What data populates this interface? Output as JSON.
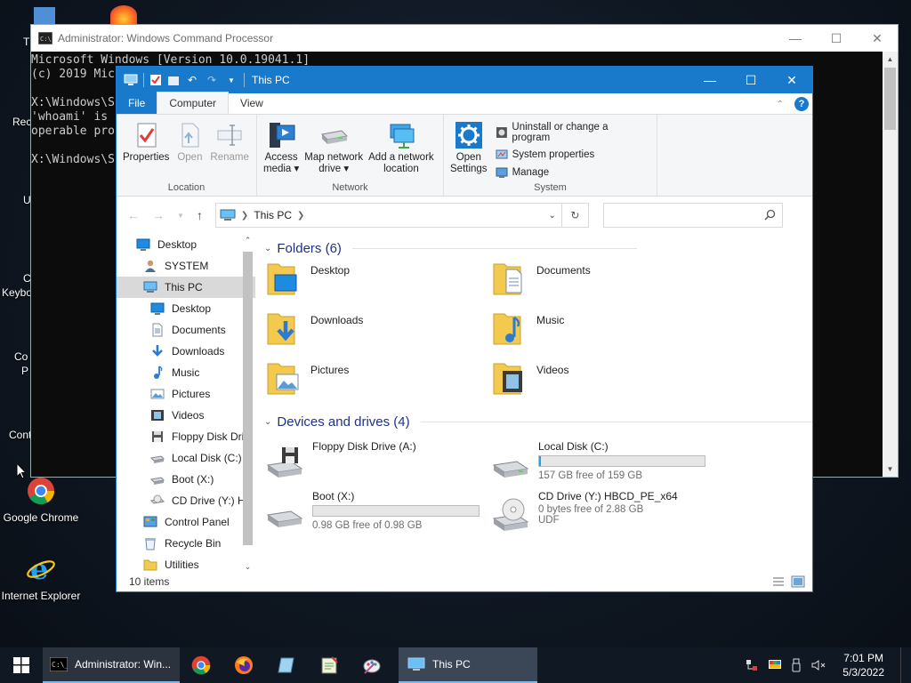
{
  "desktop": {
    "icons": [
      {
        "label": "Google Chrome"
      },
      {
        "label": "Internet Explorer"
      }
    ],
    "fragments": [
      "T",
      "Rec",
      "U",
      "C",
      "Keybo",
      "Co",
      "P",
      "Cont"
    ]
  },
  "cmd": {
    "title": "Administrator: Windows Command Processor",
    "lines": [
      "Microsoft Windows [Version 10.0.19041.1]",
      "(c) 2019 Mic",
      "",
      "X:\\Windows\\S",
      "'whoami' is",
      "operable pro",
      "",
      "X:\\Windows\\S"
    ]
  },
  "explorer": {
    "title": "This PC",
    "tabs": {
      "file": "File",
      "computer": "Computer",
      "view": "View"
    },
    "ribbon": {
      "location": {
        "name": "Location",
        "buttons": {
          "properties": "Properties",
          "open": "Open",
          "rename": "Rename"
        }
      },
      "network": {
        "name": "Network",
        "buttons": {
          "access_media_1": "Access",
          "access_media_2": "media ▾",
          "map_drive_1": "Map network",
          "map_drive_2": "drive ▾",
          "add_location_1": "Add a network",
          "add_location_2": "location"
        }
      },
      "system": {
        "name": "System",
        "open_settings_1": "Open",
        "open_settings_2": "Settings",
        "uninstall": "Uninstall or change a program",
        "system_properties": "System properties",
        "manage": "Manage"
      }
    },
    "address": {
      "crumb": "This PC",
      "search_placeholder": ""
    },
    "nav": [
      {
        "label": "Desktop",
        "indent": 0,
        "icon": "desktop-icon"
      },
      {
        "label": "SYSTEM",
        "indent": 1,
        "icon": "user-icon"
      },
      {
        "label": "This PC",
        "indent": 1,
        "icon": "pc-icon",
        "selected": true
      },
      {
        "label": "Desktop",
        "indent": 2,
        "icon": "desktop-icon"
      },
      {
        "label": "Documents",
        "indent": 2,
        "icon": "documents-icon"
      },
      {
        "label": "Downloads",
        "indent": 2,
        "icon": "downloads-icon"
      },
      {
        "label": "Music",
        "indent": 2,
        "icon": "music-icon"
      },
      {
        "label": "Pictures",
        "indent": 2,
        "icon": "pictures-icon"
      },
      {
        "label": "Videos",
        "indent": 2,
        "icon": "videos-icon"
      },
      {
        "label": "Floppy Disk Dri",
        "indent": 2,
        "icon": "floppy-icon"
      },
      {
        "label": "Local Disk (C:)",
        "indent": 2,
        "icon": "drive-icon"
      },
      {
        "label": "Boot (X:)",
        "indent": 2,
        "icon": "drive-icon"
      },
      {
        "label": "CD Drive (Y:) H",
        "indent": 2,
        "icon": "cd-icon"
      },
      {
        "label": "Control Panel",
        "indent": 1,
        "icon": "control-panel-icon"
      },
      {
        "label": "Recycle Bin",
        "indent": 1,
        "icon": "recycle-bin-icon"
      },
      {
        "label": "Utilities",
        "indent": 1,
        "icon": "folder-icon"
      }
    ],
    "folders_header": "Folders (6)",
    "folders": [
      "Desktop",
      "Documents",
      "Downloads",
      "Music",
      "Pictures",
      "Videos"
    ],
    "devices_header": "Devices and drives (4)",
    "drives": [
      {
        "name": "Floppy Disk Drive (A:)",
        "free": "",
        "used_fraction": null
      },
      {
        "name": "Local Disk (C:)",
        "free": "157 GB free of 159 GB",
        "used_fraction": 0.013
      },
      {
        "name": "Boot (X:)",
        "free": "0.98 GB free of 0.98 GB",
        "used_fraction": 0
      },
      {
        "name": "CD Drive (Y:) HBCD_PE_x64",
        "free": "0 bytes free of 2.88 GB",
        "fs": "UDF",
        "used_fraction": null
      }
    ],
    "status": "10 items"
  },
  "taskbar": {
    "cmd_label": "Administrator: Win...",
    "explorer_label": "This PC",
    "time": "7:01 PM",
    "date": "5/3/2022"
  },
  "colors": {
    "accent": "#1979ca",
    "folder": "#f3c94e",
    "bar": "#26a0da"
  }
}
